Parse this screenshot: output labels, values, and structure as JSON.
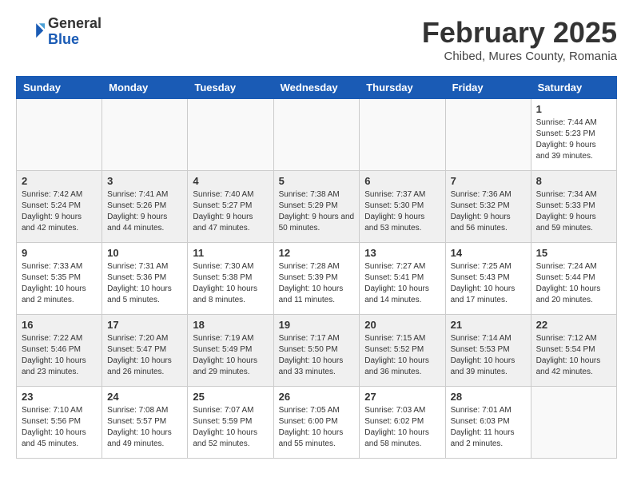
{
  "header": {
    "logo_general": "General",
    "logo_blue": "Blue",
    "month_title": "February 2025",
    "location": "Chibed, Mures County, Romania"
  },
  "days_of_week": [
    "Sunday",
    "Monday",
    "Tuesday",
    "Wednesday",
    "Thursday",
    "Friday",
    "Saturday"
  ],
  "weeks": [
    [
      {
        "day": "",
        "info": ""
      },
      {
        "day": "",
        "info": ""
      },
      {
        "day": "",
        "info": ""
      },
      {
        "day": "",
        "info": ""
      },
      {
        "day": "",
        "info": ""
      },
      {
        "day": "",
        "info": ""
      },
      {
        "day": "1",
        "info": "Sunrise: 7:44 AM\nSunset: 5:23 PM\nDaylight: 9 hours and 39 minutes."
      }
    ],
    [
      {
        "day": "2",
        "info": "Sunrise: 7:42 AM\nSunset: 5:24 PM\nDaylight: 9 hours and 42 minutes."
      },
      {
        "day": "3",
        "info": "Sunrise: 7:41 AM\nSunset: 5:26 PM\nDaylight: 9 hours and 44 minutes."
      },
      {
        "day": "4",
        "info": "Sunrise: 7:40 AM\nSunset: 5:27 PM\nDaylight: 9 hours and 47 minutes."
      },
      {
        "day": "5",
        "info": "Sunrise: 7:38 AM\nSunset: 5:29 PM\nDaylight: 9 hours and 50 minutes."
      },
      {
        "day": "6",
        "info": "Sunrise: 7:37 AM\nSunset: 5:30 PM\nDaylight: 9 hours and 53 minutes."
      },
      {
        "day": "7",
        "info": "Sunrise: 7:36 AM\nSunset: 5:32 PM\nDaylight: 9 hours and 56 minutes."
      },
      {
        "day": "8",
        "info": "Sunrise: 7:34 AM\nSunset: 5:33 PM\nDaylight: 9 hours and 59 minutes."
      }
    ],
    [
      {
        "day": "9",
        "info": "Sunrise: 7:33 AM\nSunset: 5:35 PM\nDaylight: 10 hours and 2 minutes."
      },
      {
        "day": "10",
        "info": "Sunrise: 7:31 AM\nSunset: 5:36 PM\nDaylight: 10 hours and 5 minutes."
      },
      {
        "day": "11",
        "info": "Sunrise: 7:30 AM\nSunset: 5:38 PM\nDaylight: 10 hours and 8 minutes."
      },
      {
        "day": "12",
        "info": "Sunrise: 7:28 AM\nSunset: 5:39 PM\nDaylight: 10 hours and 11 minutes."
      },
      {
        "day": "13",
        "info": "Sunrise: 7:27 AM\nSunset: 5:41 PM\nDaylight: 10 hours and 14 minutes."
      },
      {
        "day": "14",
        "info": "Sunrise: 7:25 AM\nSunset: 5:43 PM\nDaylight: 10 hours and 17 minutes."
      },
      {
        "day": "15",
        "info": "Sunrise: 7:24 AM\nSunset: 5:44 PM\nDaylight: 10 hours and 20 minutes."
      }
    ],
    [
      {
        "day": "16",
        "info": "Sunrise: 7:22 AM\nSunset: 5:46 PM\nDaylight: 10 hours and 23 minutes."
      },
      {
        "day": "17",
        "info": "Sunrise: 7:20 AM\nSunset: 5:47 PM\nDaylight: 10 hours and 26 minutes."
      },
      {
        "day": "18",
        "info": "Sunrise: 7:19 AM\nSunset: 5:49 PM\nDaylight: 10 hours and 29 minutes."
      },
      {
        "day": "19",
        "info": "Sunrise: 7:17 AM\nSunset: 5:50 PM\nDaylight: 10 hours and 33 minutes."
      },
      {
        "day": "20",
        "info": "Sunrise: 7:15 AM\nSunset: 5:52 PM\nDaylight: 10 hours and 36 minutes."
      },
      {
        "day": "21",
        "info": "Sunrise: 7:14 AM\nSunset: 5:53 PM\nDaylight: 10 hours and 39 minutes."
      },
      {
        "day": "22",
        "info": "Sunrise: 7:12 AM\nSunset: 5:54 PM\nDaylight: 10 hours and 42 minutes."
      }
    ],
    [
      {
        "day": "23",
        "info": "Sunrise: 7:10 AM\nSunset: 5:56 PM\nDaylight: 10 hours and 45 minutes."
      },
      {
        "day": "24",
        "info": "Sunrise: 7:08 AM\nSunset: 5:57 PM\nDaylight: 10 hours and 49 minutes."
      },
      {
        "day": "25",
        "info": "Sunrise: 7:07 AM\nSunset: 5:59 PM\nDaylight: 10 hours and 52 minutes."
      },
      {
        "day": "26",
        "info": "Sunrise: 7:05 AM\nSunset: 6:00 PM\nDaylight: 10 hours and 55 minutes."
      },
      {
        "day": "27",
        "info": "Sunrise: 7:03 AM\nSunset: 6:02 PM\nDaylight: 10 hours and 58 minutes."
      },
      {
        "day": "28",
        "info": "Sunrise: 7:01 AM\nSunset: 6:03 PM\nDaylight: 11 hours and 2 minutes."
      },
      {
        "day": "",
        "info": ""
      }
    ]
  ]
}
